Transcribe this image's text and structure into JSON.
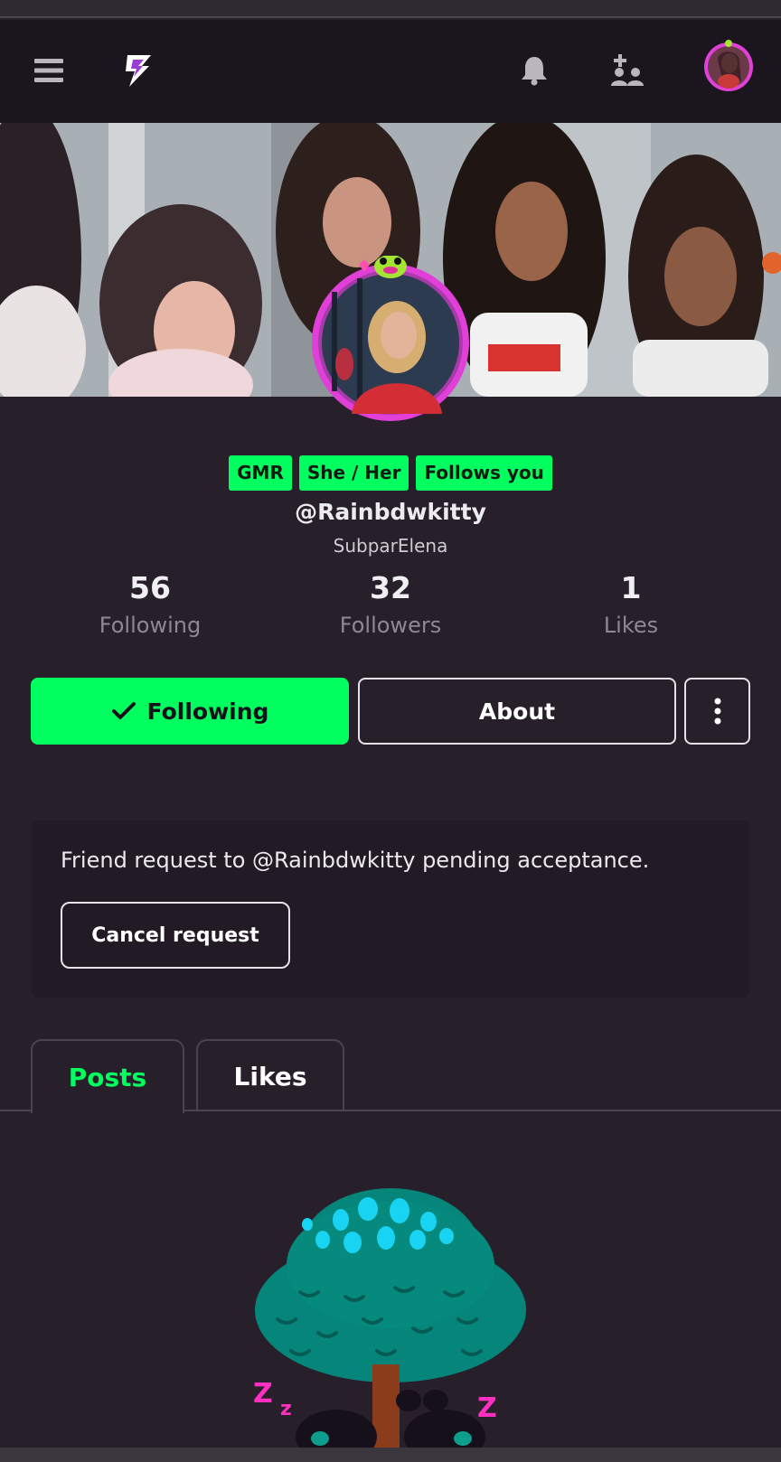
{
  "nav": {
    "menu_icon": "hamburger-icon",
    "logo_icon": "lightning-logo-icon",
    "notifications_icon": "bell-icon",
    "friends_icon": "add-friend-icon",
    "account_avatar": "user-avatar"
  },
  "profile": {
    "badges": [
      "GMR",
      "She / Her",
      "Follows you"
    ],
    "handle": "@Rainbdwkitty",
    "display_name": "SubparElena",
    "stats": [
      {
        "value": "56",
        "label": "Following"
      },
      {
        "value": "32",
        "label": "Followers"
      },
      {
        "value": "1",
        "label": "Likes"
      }
    ]
  },
  "actions": {
    "following_label": "Following",
    "about_label": "About",
    "more_icon": "vertical-dots-icon"
  },
  "friend_request": {
    "message": "Friend request to @Rainbdwkitty pending acceptance.",
    "cancel_label": "Cancel request"
  },
  "tabs": [
    {
      "label": "Posts",
      "active": true
    },
    {
      "label": "Likes",
      "active": false
    }
  ],
  "colors": {
    "accent": "#00ff5f",
    "background": "#27202b",
    "navbar": "#1b151d",
    "avatar_ring": "#e040d8"
  }
}
